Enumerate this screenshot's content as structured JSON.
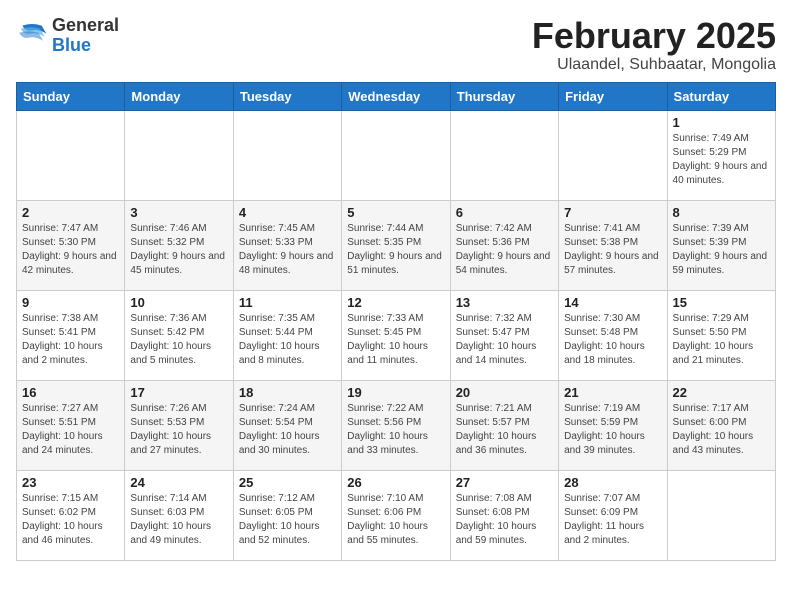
{
  "logo": {
    "general": "General",
    "blue": "Blue"
  },
  "title": {
    "month_year": "February 2025",
    "location": "Ulaandel, Suhbaatar, Mongolia"
  },
  "days_of_week": [
    "Sunday",
    "Monday",
    "Tuesday",
    "Wednesday",
    "Thursday",
    "Friday",
    "Saturday"
  ],
  "weeks": [
    [
      {
        "day": "",
        "info": ""
      },
      {
        "day": "",
        "info": ""
      },
      {
        "day": "",
        "info": ""
      },
      {
        "day": "",
        "info": ""
      },
      {
        "day": "",
        "info": ""
      },
      {
        "day": "",
        "info": ""
      },
      {
        "day": "1",
        "info": "Sunrise: 7:49 AM\nSunset: 5:29 PM\nDaylight: 9 hours and 40 minutes."
      }
    ],
    [
      {
        "day": "2",
        "info": "Sunrise: 7:47 AM\nSunset: 5:30 PM\nDaylight: 9 hours and 42 minutes."
      },
      {
        "day": "3",
        "info": "Sunrise: 7:46 AM\nSunset: 5:32 PM\nDaylight: 9 hours and 45 minutes."
      },
      {
        "day": "4",
        "info": "Sunrise: 7:45 AM\nSunset: 5:33 PM\nDaylight: 9 hours and 48 minutes."
      },
      {
        "day": "5",
        "info": "Sunrise: 7:44 AM\nSunset: 5:35 PM\nDaylight: 9 hours and 51 minutes."
      },
      {
        "day": "6",
        "info": "Sunrise: 7:42 AM\nSunset: 5:36 PM\nDaylight: 9 hours and 54 minutes."
      },
      {
        "day": "7",
        "info": "Sunrise: 7:41 AM\nSunset: 5:38 PM\nDaylight: 9 hours and 57 minutes."
      },
      {
        "day": "8",
        "info": "Sunrise: 7:39 AM\nSunset: 5:39 PM\nDaylight: 9 hours and 59 minutes."
      }
    ],
    [
      {
        "day": "9",
        "info": "Sunrise: 7:38 AM\nSunset: 5:41 PM\nDaylight: 10 hours and 2 minutes."
      },
      {
        "day": "10",
        "info": "Sunrise: 7:36 AM\nSunset: 5:42 PM\nDaylight: 10 hours and 5 minutes."
      },
      {
        "day": "11",
        "info": "Sunrise: 7:35 AM\nSunset: 5:44 PM\nDaylight: 10 hours and 8 minutes."
      },
      {
        "day": "12",
        "info": "Sunrise: 7:33 AM\nSunset: 5:45 PM\nDaylight: 10 hours and 11 minutes."
      },
      {
        "day": "13",
        "info": "Sunrise: 7:32 AM\nSunset: 5:47 PM\nDaylight: 10 hours and 14 minutes."
      },
      {
        "day": "14",
        "info": "Sunrise: 7:30 AM\nSunset: 5:48 PM\nDaylight: 10 hours and 18 minutes."
      },
      {
        "day": "15",
        "info": "Sunrise: 7:29 AM\nSunset: 5:50 PM\nDaylight: 10 hours and 21 minutes."
      }
    ],
    [
      {
        "day": "16",
        "info": "Sunrise: 7:27 AM\nSunset: 5:51 PM\nDaylight: 10 hours and 24 minutes."
      },
      {
        "day": "17",
        "info": "Sunrise: 7:26 AM\nSunset: 5:53 PM\nDaylight: 10 hours and 27 minutes."
      },
      {
        "day": "18",
        "info": "Sunrise: 7:24 AM\nSunset: 5:54 PM\nDaylight: 10 hours and 30 minutes."
      },
      {
        "day": "19",
        "info": "Sunrise: 7:22 AM\nSunset: 5:56 PM\nDaylight: 10 hours and 33 minutes."
      },
      {
        "day": "20",
        "info": "Sunrise: 7:21 AM\nSunset: 5:57 PM\nDaylight: 10 hours and 36 minutes."
      },
      {
        "day": "21",
        "info": "Sunrise: 7:19 AM\nSunset: 5:59 PM\nDaylight: 10 hours and 39 minutes."
      },
      {
        "day": "22",
        "info": "Sunrise: 7:17 AM\nSunset: 6:00 PM\nDaylight: 10 hours and 43 minutes."
      }
    ],
    [
      {
        "day": "23",
        "info": "Sunrise: 7:15 AM\nSunset: 6:02 PM\nDaylight: 10 hours and 46 minutes."
      },
      {
        "day": "24",
        "info": "Sunrise: 7:14 AM\nSunset: 6:03 PM\nDaylight: 10 hours and 49 minutes."
      },
      {
        "day": "25",
        "info": "Sunrise: 7:12 AM\nSunset: 6:05 PM\nDaylight: 10 hours and 52 minutes."
      },
      {
        "day": "26",
        "info": "Sunrise: 7:10 AM\nSunset: 6:06 PM\nDaylight: 10 hours and 55 minutes."
      },
      {
        "day": "27",
        "info": "Sunrise: 7:08 AM\nSunset: 6:08 PM\nDaylight: 10 hours and 59 minutes."
      },
      {
        "day": "28",
        "info": "Sunrise: 7:07 AM\nSunset: 6:09 PM\nDaylight: 11 hours and 2 minutes."
      },
      {
        "day": "",
        "info": ""
      }
    ]
  ]
}
